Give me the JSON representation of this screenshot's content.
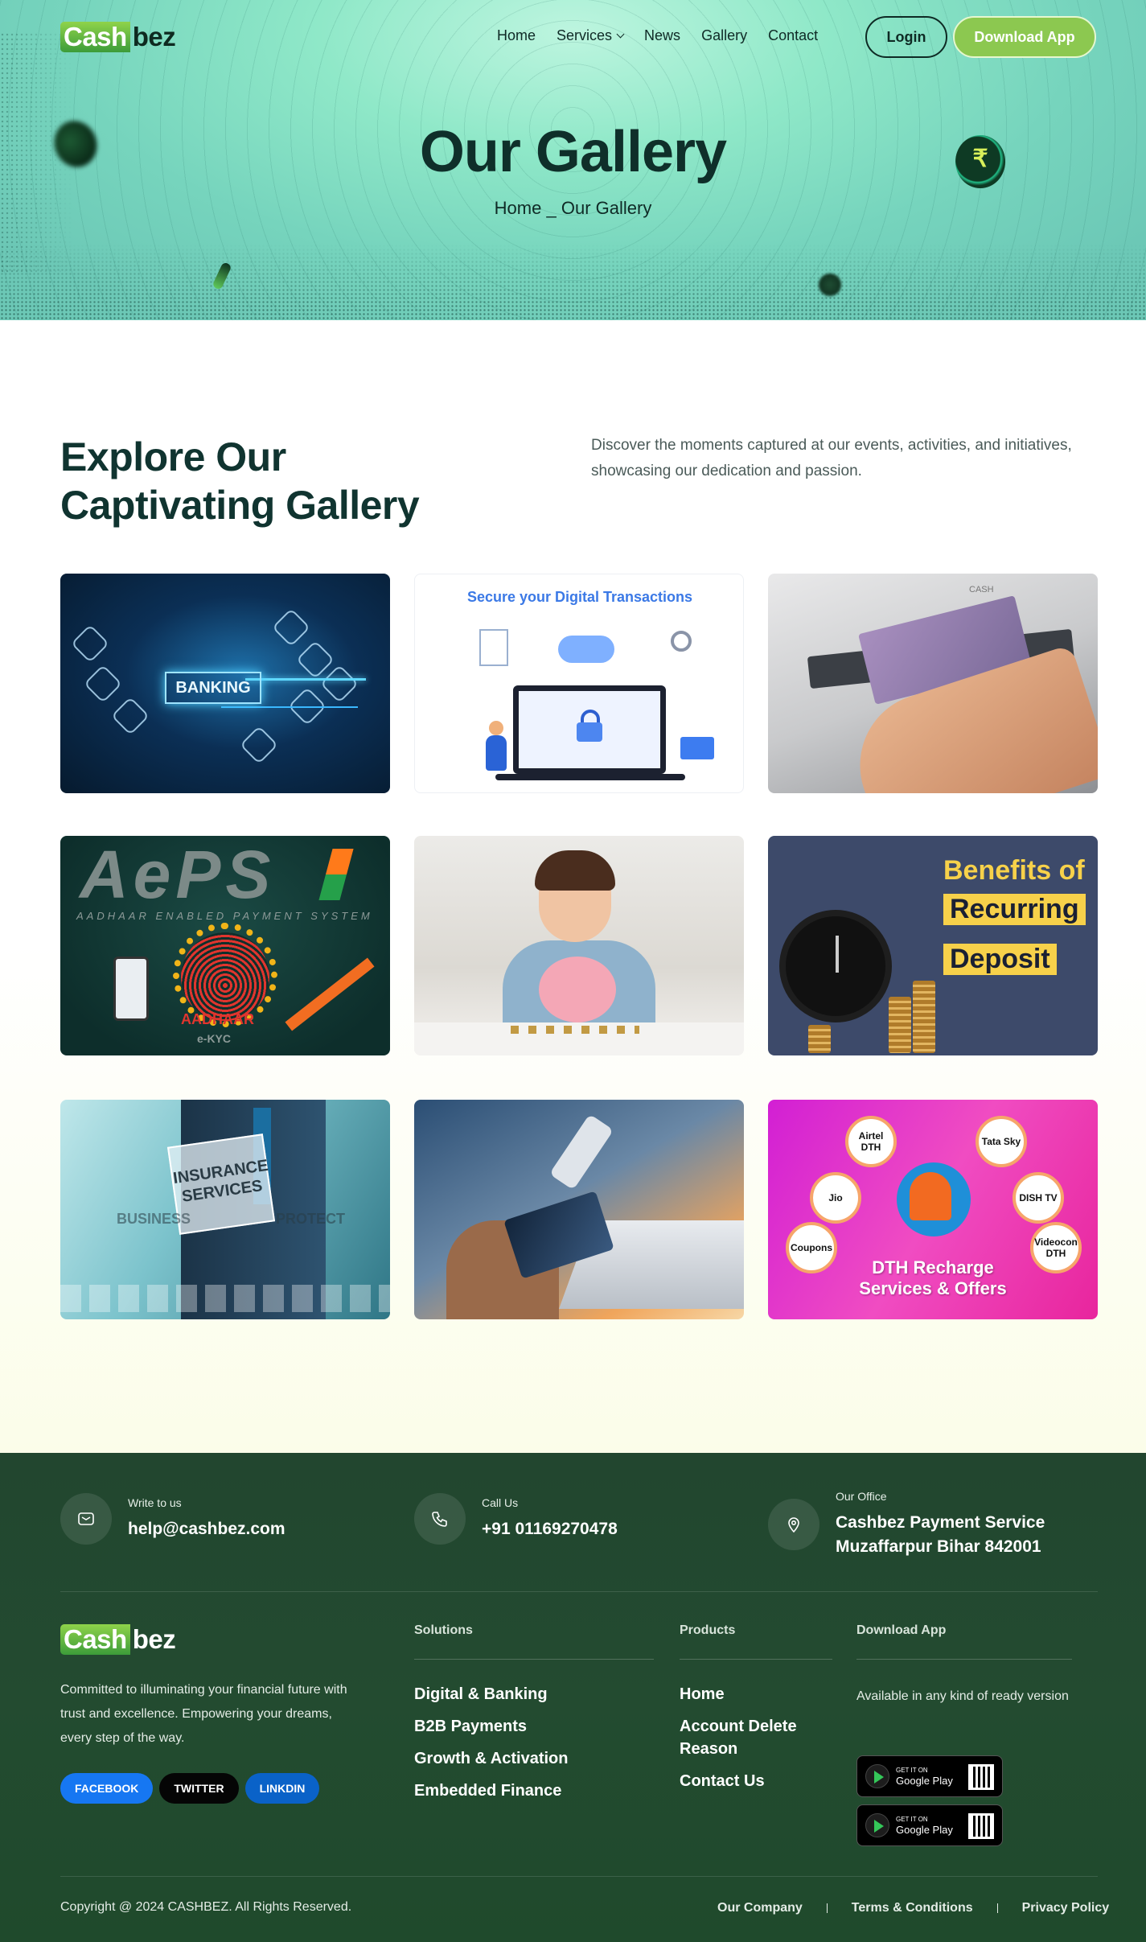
{
  "brand": {
    "logo_part1": "Cash",
    "logo_part2": "bez"
  },
  "nav": {
    "links": [
      "Home",
      "Services",
      "News",
      "Gallery",
      "Contact"
    ],
    "login": "Login",
    "download": "Download App"
  },
  "hero": {
    "title": "Our Gallery",
    "breadcrumb_home": "Home",
    "breadcrumb_sep": "_",
    "breadcrumb_current": "Our Gallery"
  },
  "gallery": {
    "title_line1": "Explore Our",
    "title_line2": "Captivating Gallery",
    "description": "Discover the moments captured at our events, activities, and initiatives, showcasing our dedication and passion.",
    "images": [
      {
        "label": "BANKING"
      },
      {
        "label": "Secure your Digital Transactions"
      },
      {
        "label": "CASH"
      },
      {
        "label": "AePS",
        "sub": "AADHAAR ENABLED PAYMENT SYSTEM",
        "mark": "AADHAAR",
        "kyc": "e-KYC"
      },
      {
        "label": ""
      },
      {
        "line1": "Benefits of",
        "line2": "Recurring",
        "line3": "Deposit"
      },
      {
        "line1": "INSURANCE",
        "line2": "SERVICES",
        "tag1": "BUSINESS",
        "tag2": "PROTECT"
      },
      {
        "label": ""
      },
      {
        "bubbles": [
          "Airtel DTH",
          "Tata Sky",
          "Jio",
          "DISH TV",
          "Coupons",
          "Videocon DTH"
        ],
        "caption1": "DTH Recharge",
        "caption2": "Services & Offers"
      }
    ]
  },
  "footer": {
    "email_label": "Write to us",
    "email": "help@cashbez.com",
    "phone_label": "Call Us",
    "phone": "+91 01169270478",
    "office_label": "Our Office",
    "office_line1": "Cashbez Payment Service",
    "office_line2": "Muzaffarpur Bihar 842001",
    "about": "Committed to illuminating your financial future with trust and excellence. Empowering your dreams, every step of the way.",
    "socials": [
      "FACEBOOK",
      "TWITTER",
      "LINKDIN"
    ],
    "solutions_heading": "Solutions",
    "solutions": [
      "Digital & Banking",
      "B2B Payments",
      "Growth & Activation",
      "Embedded Finance"
    ],
    "products_heading": "Products",
    "products": [
      "Home",
      "Account Delete Reason",
      "Contact Us"
    ],
    "download_heading": "Download App",
    "download_text": "Available in any kind of ready version",
    "gplay_small": "GET IT ON",
    "gplay_big": "Google Play",
    "copyright": "Copyright @ 2024 CASHBEZ. All Rights Reserved.",
    "bottom_links": [
      "Our Company",
      "Terms & Conditions",
      "Privacy Policy"
    ]
  },
  "colors": {
    "accent_green": "#8cc850",
    "dark_teal": "#0f2f2a",
    "footer_bg": "#234b30",
    "facebook": "#1677f2",
    "linkedin": "#0a62c8"
  }
}
